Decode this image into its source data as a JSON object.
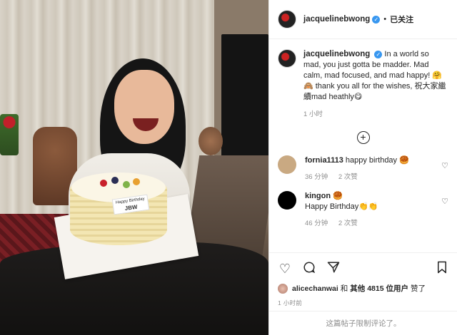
{
  "post": {
    "username": "jacquelinebwong",
    "verified_mark": "✓",
    "separator": "•",
    "follow_status": "已关注",
    "caption_text": "In a world so mad, you just gotta be madder. Mad calm, mad focused, and mad happy! 🤗🙈 thank you all for the wishes, 祝大家繼續mad heathly😋",
    "caption_time": "1 小时",
    "photo": {
      "cake_label_line1": "Happy Birthday",
      "cake_label_line2": "JBW"
    }
  },
  "comments": [
    {
      "username": "fornia1113",
      "text": "happy birthday 🥮",
      "time": "36 分钟",
      "reply_count": "2 次赞",
      "avatar_color": "#c9a982"
    },
    {
      "username": "kingon",
      "user_badge": "🥮",
      "text": "Happy Birthday👏👏",
      "time": "46 分钟",
      "reply_count": "2 次赞",
      "avatar_color": "#000000"
    }
  ],
  "actions": {
    "like_icon": "heart-icon",
    "comment_icon": "comment-icon",
    "share_icon": "share-icon",
    "save_icon": "bookmark-icon"
  },
  "likes": {
    "liker": "alicechanwai",
    "connector": "和",
    "others": "其他 4815 位用户",
    "suffix": "赞了"
  },
  "post_time": "1 小时前",
  "comments_limited": "这篇帖子限制评论了。",
  "colors": {
    "verified_blue": "#3897f0",
    "meta_gray": "#8e8e8e",
    "text": "#262626"
  }
}
